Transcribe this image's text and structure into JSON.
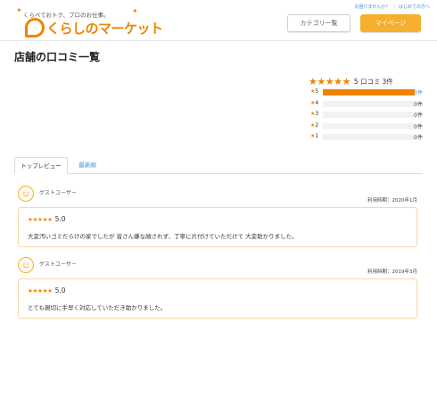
{
  "header": {
    "tagline": "くらべておトク、プロのお仕事。",
    "logo_text": "くらしのマーケット",
    "links": [
      "お困りませんか？",
      "はじめての方へ"
    ],
    "category_button": "カテゴリ一覧",
    "mypage_button": "マイページ"
  },
  "page_title": "店舗の口コミ一覧",
  "summary": {
    "stars": "★★★★★",
    "score": "5 口コミ",
    "count": "3件",
    "distribution": [
      {
        "label": "5",
        "count": "3件",
        "fraction": 1.0
      },
      {
        "label": "4",
        "count": "0件",
        "fraction": 0
      },
      {
        "label": "3",
        "count": "0件",
        "fraction": 0
      },
      {
        "label": "2",
        "count": "0件",
        "fraction": 0
      },
      {
        "label": "1",
        "count": "0件",
        "fraction": 0
      }
    ],
    "accent": "#f08300"
  },
  "tabs": [
    "トップレビュー",
    "最新順"
  ],
  "reviews": [
    {
      "user": "ゲストユーザー",
      "date": "利用時期：2020年1月",
      "stars": "★★★★★",
      "score": "5.0",
      "text": "大変汚いゴミだらけの家でしたが 皆さん嫌な顔されず、丁寧に片付けていただけて 大変助かりました。"
    },
    {
      "user": "ゲストユーザー",
      "date": "利用時期：2019年3月",
      "stars": "★★★★★",
      "score": "5.0",
      "text": "とても親切に手早く対応していただき助かりました。"
    }
  ]
}
